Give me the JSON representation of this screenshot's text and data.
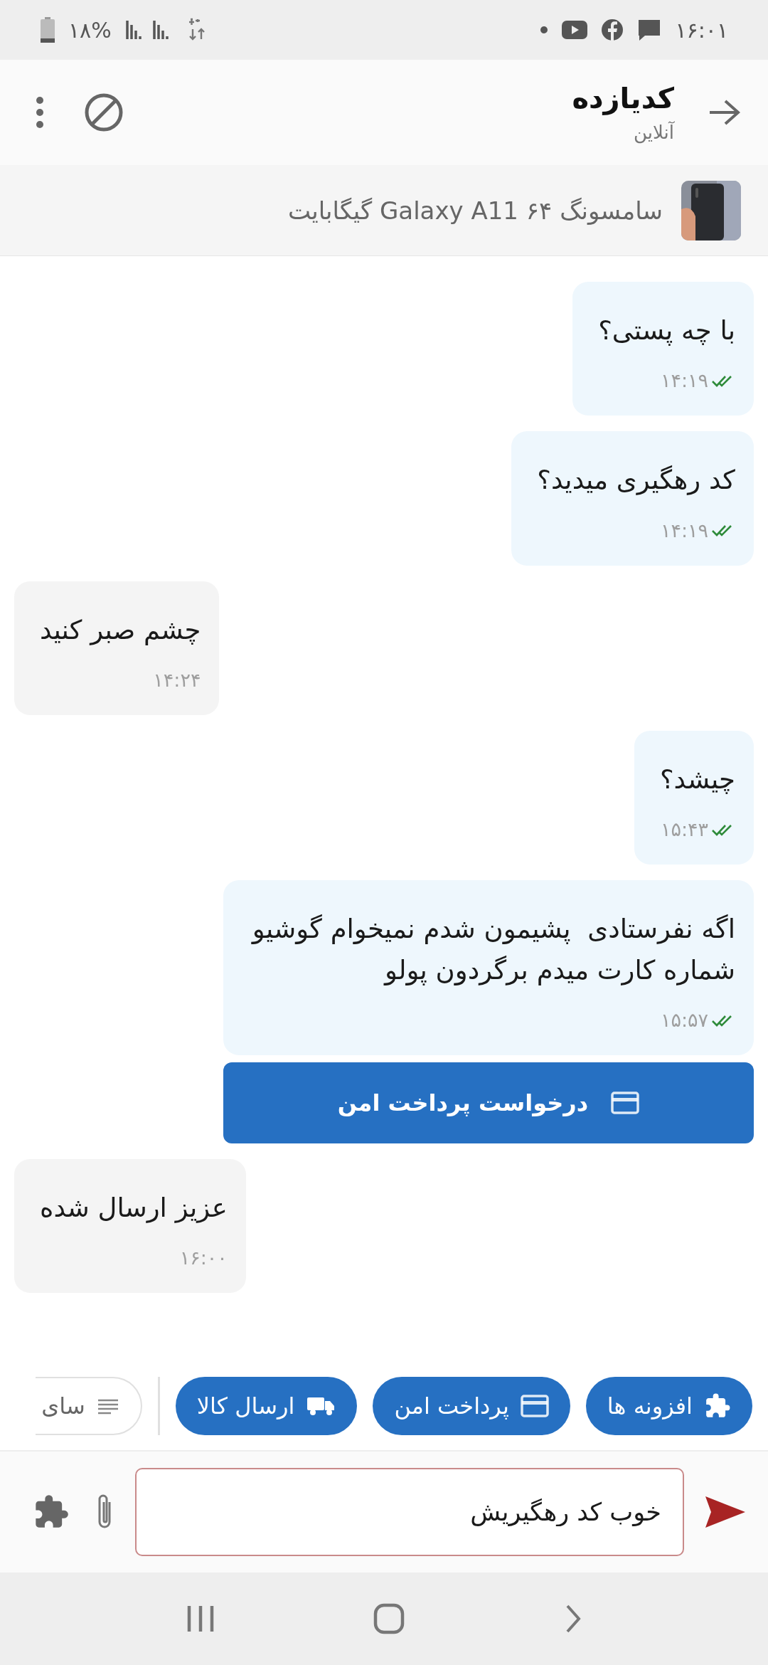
{
  "status_bar": {
    "time": "۱۶:۰۱",
    "battery": "۱۸%"
  },
  "header": {
    "title": "کدیازده",
    "subtitle": "آنلاین"
  },
  "product": {
    "title": "سامسونگ Galaxy A11 ۶۴ گیگابایت",
    "kind": "picture"
  },
  "messages": [
    {
      "kind": "sent",
      "text": "با چه پستی؟",
      "time": "۱۴:۱۹",
      "seen": true
    },
    {
      "kind": "sent",
      "text": "کد رهگیری میدید؟",
      "time": "۱۴:۱۹",
      "seen": true
    },
    {
      "kind": "received",
      "text": "چشم صبر کنید",
      "time": "۱۴:۲۴"
    },
    {
      "kind": "sent",
      "text": "چیشد؟",
      "time": "۱۵:۴۳",
      "seen": true
    },
    {
      "kind": "sent",
      "text": "اگه نفرستادی  پشیمون شدم نمیخوام گوشیو شماره کارت میدم برگردون پولو",
      "time": "۱۵:۵۷",
      "seen": true
    },
    {
      "kind": "action",
      "text": "درخواست پرداخت امن"
    },
    {
      "kind": "received",
      "text": "عزیز ارسال شده",
      "time": "۱۶:۰۰"
    }
  ],
  "chips": [
    {
      "kind": "plugin",
      "label": "افزونه ها"
    },
    {
      "kind": "payment",
      "label": "پرداخت امن"
    },
    {
      "kind": "shipping",
      "label": "ارسال کالا"
    },
    {
      "kind": "other",
      "label": "سای"
    }
  ],
  "composer": {
    "value": "خوب کد رهگیریش"
  }
}
